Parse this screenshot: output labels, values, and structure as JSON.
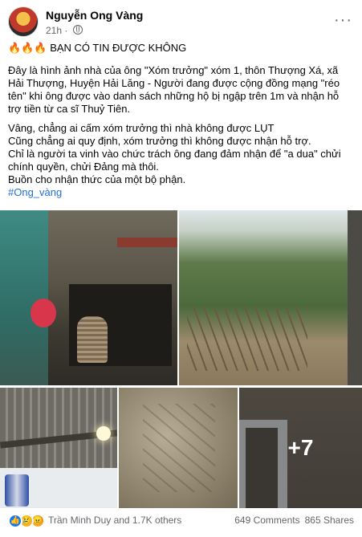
{
  "post": {
    "author": "Nguyễn Ong Vàng",
    "time": "21h",
    "title_emoji": "🔥🔥🔥",
    "title": "BẠN CÓ TIN ĐƯỢC KHÔNG",
    "paragraph1": "Đây là hình ảnh nhà của ông \"Xóm trưởng\" xóm 1, thôn Thượng Xá, xã Hải Thượng, Huyện Hải Lăng - Người đang được cộng đồng mạng \"réo tên\" khi ông được vào danh sách những hộ bị ngập trên 1m và nhận hỗ trợ tiền từ ca sĩ Thuỷ Tiên.",
    "lines": [
      "Vâng, chẳng ai cấm xóm trưởng thì nhà không được LỤT",
      "Cũng chẳng ai quy định, xóm trưởng thì không được nhận hỗ trợ.",
      "Chỉ là người ta vinh vào chức trách ông đang đảm nhận để \"a dua\" chửi chính quyền, chửi Đảng mà thôi.",
      "Buồn cho nhận thức của một bộ phận."
    ],
    "hashtag": "#Ong_vàng",
    "more_photos": "+7"
  },
  "footer": {
    "reaction_icons": [
      "like-icon",
      "sad-icon",
      "angry-icon"
    ],
    "reactions_text": "Trần Minh Duy and 1.7K others",
    "comments": "649 Comments",
    "shares": "865 Shares"
  },
  "colors": {
    "link": "#216fdb",
    "secondary_text": "#65676b",
    "like": "#1877f2"
  }
}
